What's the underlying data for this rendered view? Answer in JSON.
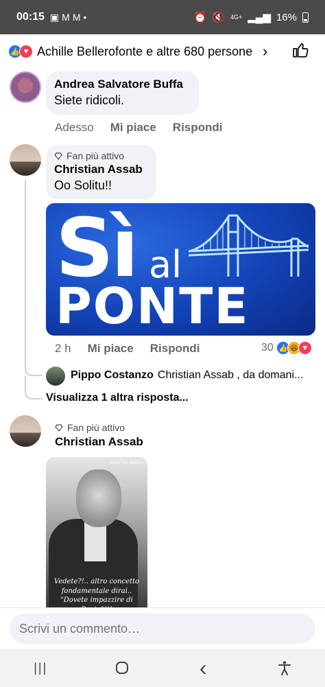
{
  "status_bar": {
    "time": "00:15",
    "network": "4G+",
    "battery": "16%"
  },
  "reactions_bar": {
    "summary": "Achille Bellerofonte e altre 680 persone"
  },
  "comments": [
    {
      "author": "Andrea Salvatore Buffa",
      "text": "Siete ridicoli.",
      "time": "Adesso",
      "like_label": "Mi piace",
      "reply_label": "Rispondi"
    },
    {
      "badge": "Fan più attivo",
      "author": "Christian Assab",
      "text": "Oo Solitu!!",
      "image": {
        "line1": "Sì",
        "line2": "al",
        "line3": "PONTE"
      },
      "time": "2 h",
      "like_label": "Mi piace",
      "reply_label": "Rispondi",
      "reaction_count": "30",
      "reply_preview": {
        "author": "Pippo Costanzo",
        "text": "Christian Assab , da domani..."
      },
      "view_more": "Visualizza 1 altra risposta..."
    },
    {
      "badge": "Fan più attivo",
      "author": "Christian Assab",
      "image": {
        "watermark": "dear ho ponte",
        "caption": "Vedete?!.. altro concetto fondamentale dirai.. \"Dovete impazzire di Ponte\"!!!"
      }
    }
  ],
  "composer": {
    "placeholder": "Scrivi un commento…"
  },
  "nav": {
    "recents": "|||",
    "home": "○",
    "back": "‹"
  }
}
